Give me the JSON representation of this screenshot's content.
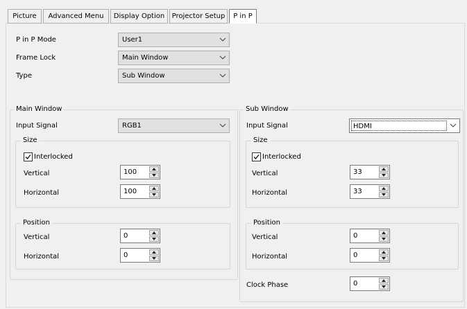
{
  "tabs": [
    "Picture",
    "Advanced Menu",
    "Display Option",
    "Projector Setup",
    "P in P"
  ],
  "active_tab": "P in P",
  "top": {
    "mode_label": "P in P Mode",
    "mode_value": "User1",
    "frame_lock_label": "Frame Lock",
    "frame_lock_value": "Main Window",
    "type_label": "Type",
    "type_value": "Sub Window"
  },
  "main_window": {
    "title": "Main Window",
    "input_label": "Input Signal",
    "input_value": "RGB1",
    "size": {
      "title": "Size",
      "interlocked_label": "Interlocked",
      "interlocked_checked": true,
      "vertical_label": "Vertical",
      "vertical_value": "100",
      "horizontal_label": "Horizontal",
      "horizontal_value": "100"
    },
    "position": {
      "title": "Position",
      "vertical_label": "Vertical",
      "vertical_value": "0",
      "horizontal_label": "Horizontal",
      "horizontal_value": "0"
    }
  },
  "sub_window": {
    "title": "Sub Window",
    "input_label": "Input Signal",
    "input_value": "HDMI",
    "size": {
      "title": "Size",
      "interlocked_label": "Interlocked",
      "interlocked_checked": true,
      "vertical_label": "Vertical",
      "vertical_value": "33",
      "horizontal_label": "Horizontal",
      "horizontal_value": "33"
    },
    "position": {
      "title": "Position",
      "vertical_label": "Vertical",
      "vertical_value": "0",
      "horizontal_label": "Horizontal",
      "horizontal_value": "0"
    },
    "clock_phase_label": "Clock Phase",
    "clock_phase_value": "0"
  }
}
